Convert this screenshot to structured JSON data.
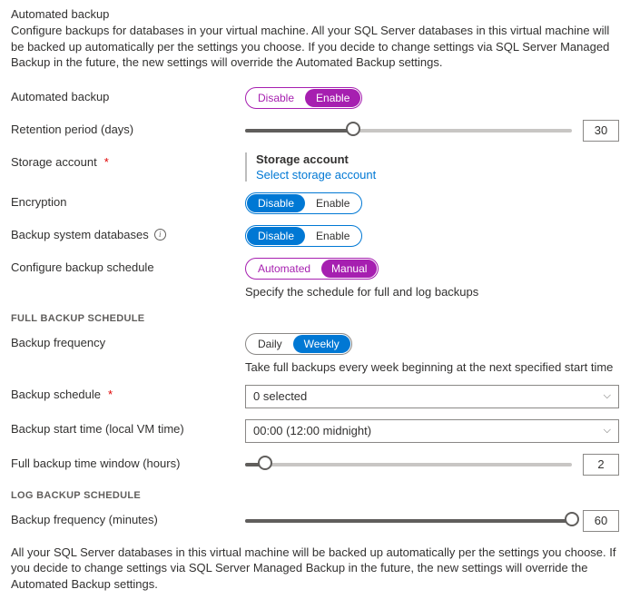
{
  "header": {
    "title": "Automated backup",
    "description": "Configure backups for databases in your virtual machine. All your SQL Server databases in this virtual machine will be backed up automatically per the settings you choose. If you decide to change settings via SQL Server Managed Backup in the future, the new settings will override the Automated Backup settings."
  },
  "automated_backup": {
    "label": "Automated backup",
    "disable": "Disable",
    "enable": "Enable"
  },
  "retention": {
    "label": "Retention period (days)",
    "value": "30",
    "fill_pct": 33
  },
  "storage": {
    "label": "Storage account",
    "title": "Storage account",
    "link": "Select storage account"
  },
  "encryption": {
    "label": "Encryption",
    "disable": "Disable",
    "enable": "Enable"
  },
  "sysdbs": {
    "label": "Backup system databases",
    "disable": "Disable",
    "enable": "Enable"
  },
  "schedule": {
    "label": "Configure backup schedule",
    "auto": "Automated",
    "manual": "Manual",
    "hint": "Specify the schedule for full and log backups"
  },
  "full_section": "FULL BACKUP SCHEDULE",
  "freq": {
    "label": "Backup frequency",
    "daily": "Daily",
    "weekly": "Weekly",
    "hint": "Take full backups every week beginning at the next specified start time"
  },
  "backup_schedule": {
    "label": "Backup schedule",
    "value": "0 selected"
  },
  "start_time": {
    "label": "Backup start time (local VM time)",
    "value": "00:00 (12:00 midnight)"
  },
  "window": {
    "label": "Full backup time window (hours)",
    "value": "2",
    "fill_pct": 6
  },
  "log_section": "LOG BACKUP SCHEDULE",
  "log_freq": {
    "label": "Backup frequency (minutes)",
    "value": "60",
    "fill_pct": 100
  },
  "footer": "All your SQL Server databases in this virtual machine will be backed up automatically per the settings you choose. If you decide to change settings via SQL Server Managed Backup in the future, the new settings will override the Automated Backup settings."
}
